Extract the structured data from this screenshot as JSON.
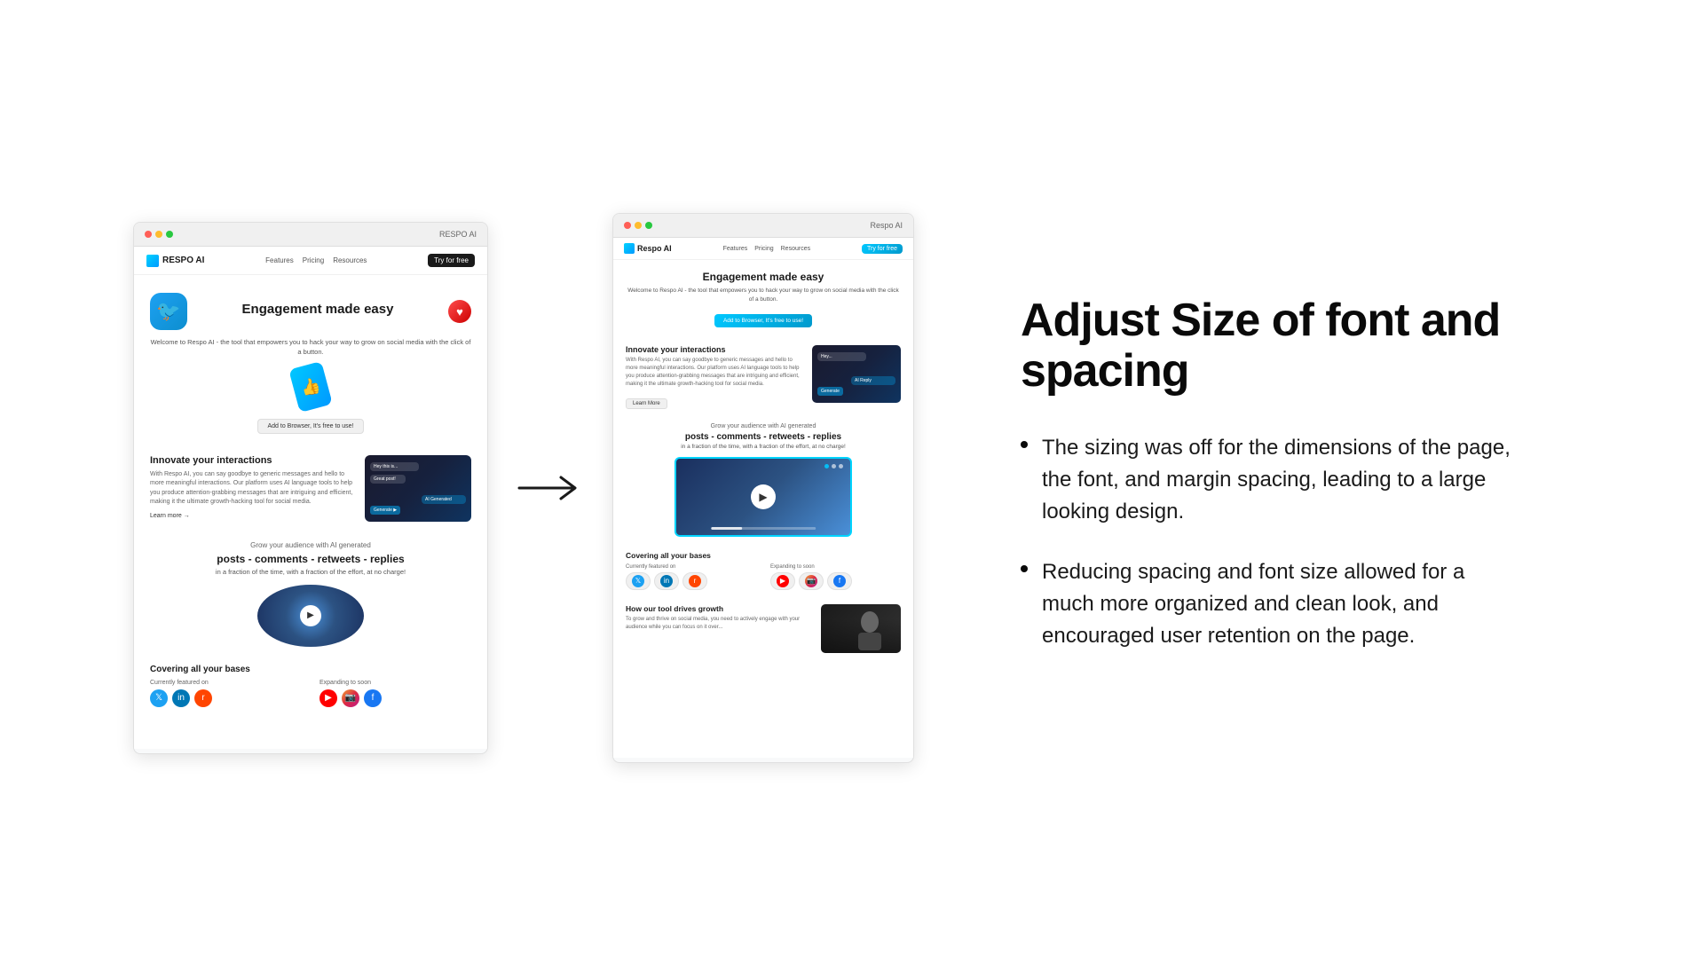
{
  "screenshots": {
    "left_mock": {
      "navbar": {
        "logo_text": "RESPO AI",
        "nav_links": [
          "Features",
          "Pricing",
          "Resources"
        ],
        "cta_button": "Try for free"
      },
      "hero": {
        "title": "Engagement made easy",
        "subtitle": "Welcome to Respo AI - the tool that empowers you to hack your way to grow on social media with the click of a button.",
        "cta": "Add to Browser, It's free to use!"
      },
      "innovate": {
        "title": "Innovate your interactions",
        "body": "With Respo AI, you can say goodbye to generic messages and hello to more meaningful interactions. Our platform uses AI language tools to help you produce attention-grabbing messages that are intriguing and efficient, making it the ultimate growth-hacking tool for social media.",
        "learn_more": "Learn more →"
      },
      "audience": {
        "pre": "Grow your audience with AI generated",
        "main": "posts - comments - retweets - replies",
        "sub": "in a fraction of the time, with a fraction of the effort, at no charge!"
      },
      "covering": {
        "title": "Covering all your bases",
        "featured_label": "Currently featured on",
        "expanding_label": "Expanding to soon"
      }
    },
    "right_mock": {
      "navbar": {
        "logo_text": "Respo AI",
        "nav_links": [
          "Features",
          "Pricing",
          "Resources"
        ],
        "cta_button": "Try for free"
      },
      "hero": {
        "title": "Engagement made easy",
        "subtitle": "Welcome to Respo AI - the tool that empowers you to hack your way to grow on social media with the click of a button.",
        "cta": "Add to Browser, It's free to use!"
      },
      "innovate": {
        "title": "Innovate your interactions",
        "body": "With Respo AI, you can say goodbye to generic messages and hello to more meaningful interactions. Our platform uses AI language tools to help you produce attention-grabbing messages that are intriguing and efficient, making it the ultimate growth-hacking tool for social media.",
        "learn_more_btn": "Learn More"
      },
      "audience": {
        "pre": "Grow your audience with AI generated",
        "main": "posts - comments - retweets - replies",
        "sub": "in a fraction of the time, with a fraction of the effort, at no charge!"
      },
      "covering": {
        "title": "Covering all your bases",
        "featured_label": "Currently featured on",
        "expanding_label": "Expanding to soon"
      },
      "how_it_works": {
        "title": "How our tool drives growth",
        "body": "To grow and thrive on social media, you need to actively engage with your audience while you can focus on it over..."
      }
    }
  },
  "arrow": "→",
  "right_panel": {
    "title": "Adjust Size of font and spacing",
    "bullets": [
      {
        "text": "The sizing was off for the dimensions of the page, the font, and margin spacing, leading to a large looking design."
      },
      {
        "text": "Reducing spacing and font size allowed for a much more organized and clean look, and encouraged user retention on the page."
      }
    ]
  }
}
